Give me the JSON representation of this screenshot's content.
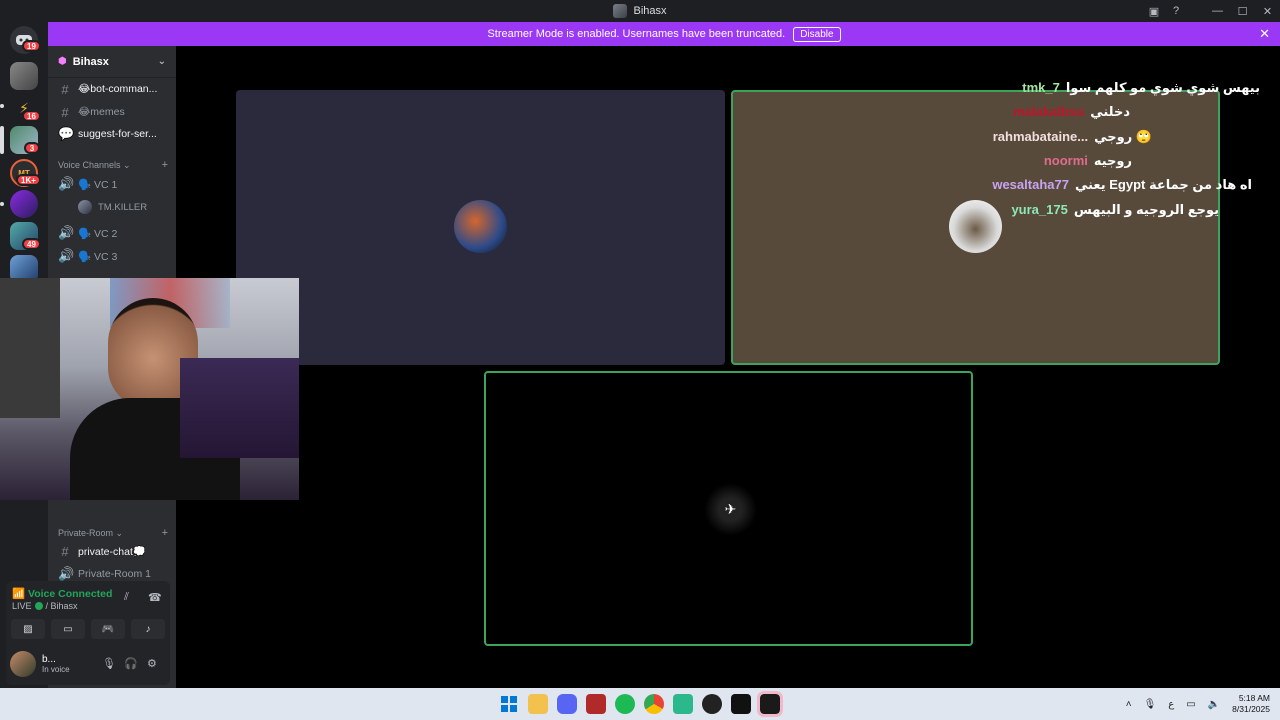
{
  "window": {
    "title": "Bihasx"
  },
  "banner": {
    "text": "Streamer Mode is enabled. Usernames have been truncated.",
    "disable_label": "Disable",
    "close_glyph": "✕"
  },
  "rail": {
    "badges": [
      "19",
      "16",
      "3",
      "1K+",
      "49"
    ],
    "home_label": "Direct Messages"
  },
  "sidebar": {
    "server_name": "Bihasx",
    "text_channels": [
      {
        "label": "😂bot-comman...",
        "unread": true
      },
      {
        "label": "😂memes",
        "unread": false
      },
      {
        "label": "suggest-for-ser...",
        "unread": true
      }
    ],
    "voice_category": "Voice Channels ⌄",
    "voice_channels": [
      {
        "label": "🗣️ VC 1"
      },
      {
        "label": "🗣️ VC 2"
      },
      {
        "label": "🗣️ VC 3"
      }
    ],
    "voice_user": "TM.KILLER",
    "private_category": "Private-Room ⌄",
    "private_channels": [
      {
        "label": "private-chat💭",
        "unread": true
      },
      {
        "label": "Private-Room 1",
        "unread": false
      }
    ]
  },
  "voice_panel": {
    "status": "Voice Connected",
    "live": "LIVE",
    "channel": "/ Bihasx"
  },
  "user": {
    "name": "b...",
    "status": "In voice"
  },
  "chat": [
    {
      "user": "tmk_7",
      "color": "#a6e3a1",
      "text": "بيهس شوي شوي مو كلهم سوا"
    },
    {
      "user": "malakalbsu",
      "color": "#c0142b",
      "text": "دخلني"
    },
    {
      "user": "rahmabataine...",
      "color": "#f2dede",
      "text": "روجي 🙄"
    },
    {
      "user": "noormi",
      "color": "#e06c8c",
      "text": "روجيه"
    },
    {
      "user": "wesaltaha77",
      "color": "#c9a3f0",
      "text": "يعني Egypt اه هاد من جماعة"
    },
    {
      "user": "yura_175",
      "color": "#8ee7b6",
      "text": "يوجع الروجيه و البيهس"
    }
  ],
  "taskbar": {
    "time": "5:18 AM",
    "date": "8/31/2025",
    "lang": "ع"
  }
}
